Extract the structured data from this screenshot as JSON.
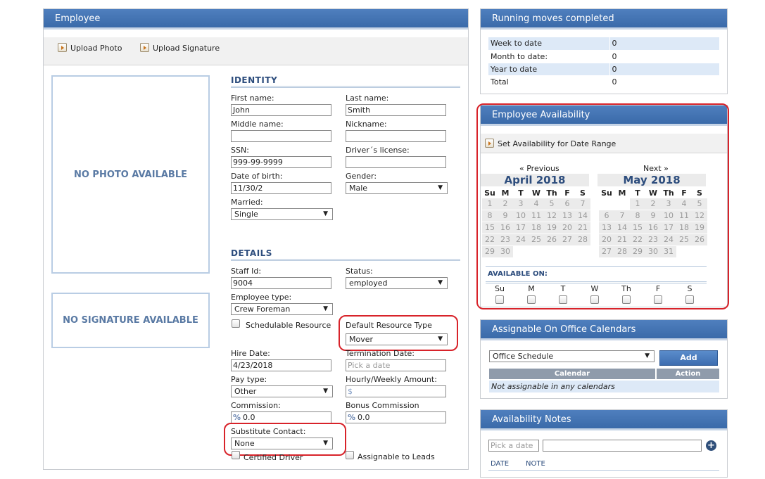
{
  "employee": {
    "title": "Employee",
    "toolbar": {
      "upload_photo": "Upload Photo",
      "upload_signature": "Upload Signature"
    },
    "photo_placeholder": "NO PHOTO AVAILABLE",
    "signature_placeholder": "NO SIGNATURE AVAILABLE",
    "identity": {
      "title": "IDENTITY",
      "first_name_label": "First name:",
      "first_name": "John",
      "last_name_label": "Last name:",
      "last_name": "Smith",
      "middle_name_label": "Middle name:",
      "middle_name": "",
      "nickname_label": "Nickname:",
      "nickname": "",
      "ssn_label": "SSN:",
      "ssn": "999-99-9999",
      "drivers_license_label": "Driver´s license:",
      "drivers_license": "",
      "dob_label": "Date of birth:",
      "dob": "11/30/2",
      "gender_label": "Gender:",
      "gender": "Male",
      "married_label": "Married:",
      "married": "Single"
    },
    "details": {
      "title": "DETAILS",
      "staff_id_label": "Staff Id:",
      "staff_id": "9004",
      "status_label": "Status:",
      "status": "employed",
      "employee_type_label": "Employee type:",
      "employee_type": "Crew Foreman",
      "schedulable_label": "Schedulable Resource",
      "default_resource_label": "Default Resource Type",
      "default_resource": "Mover",
      "hire_date_label": "Hire Date:",
      "hire_date": "4/23/2018",
      "termination_label": "Termination Date:",
      "termination_placeholder": "Pick a date",
      "pay_type_label": "Pay type:",
      "pay_type": "Other",
      "hourly_label": "Hourly/Weekly Amount:",
      "hourly_placeholder": "$",
      "commission_label": "Commission:",
      "commission": "0.0",
      "bonus_label": "Bonus Commission",
      "bonus": "0.0",
      "percent_symbol": "%",
      "substitute_label": "Substitute Contact:",
      "substitute": "None",
      "certified_label": "Certified Driver",
      "assignable_leads_label": "Assignable to Leads"
    }
  },
  "running_moves": {
    "title": "Running moves completed",
    "rows": [
      {
        "label": "Week to date",
        "value": "0"
      },
      {
        "label": "Month to date:",
        "value": "0"
      },
      {
        "label": "Year to date",
        "value": "0"
      },
      {
        "label": "Total",
        "value": "0"
      }
    ]
  },
  "availability": {
    "title": "Employee Availability",
    "set_range_label": "Set Availability for Date Range",
    "prev_label": "« Previous",
    "next_label": "Next »",
    "day_names": [
      "Su",
      "M",
      "T",
      "W",
      "Th",
      "F",
      "S"
    ],
    "april": {
      "title": "April 2018",
      "weeks": [
        [
          "1",
          "2",
          "3",
          "4",
          "5",
          "6",
          "7"
        ],
        [
          "8",
          "9",
          "10",
          "11",
          "12",
          "13",
          "14"
        ],
        [
          "15",
          "16",
          "17",
          "18",
          "19",
          "20",
          "21"
        ],
        [
          "22",
          "23",
          "24",
          "25",
          "26",
          "27",
          "28"
        ],
        [
          "29",
          "30",
          "",
          "",
          "",
          "",
          ""
        ]
      ]
    },
    "may": {
      "title": "May 2018",
      "weeks": [
        [
          "",
          "",
          "1",
          "2",
          "3",
          "4",
          "5"
        ],
        [
          "6",
          "7",
          "8",
          "9",
          "10",
          "11",
          "12"
        ],
        [
          "13",
          "14",
          "15",
          "16",
          "17",
          "18",
          "19"
        ],
        [
          "20",
          "21",
          "22",
          "23",
          "24",
          "25",
          "26"
        ],
        [
          "27",
          "28",
          "29",
          "30",
          "31",
          "",
          ""
        ]
      ]
    },
    "available_on_label": "AVAILABLE ON:",
    "weekday_labels": [
      "Su",
      "M",
      "T",
      "W",
      "Th",
      "F",
      "S"
    ]
  },
  "office_calendars": {
    "title": "Assignable On Office Calendars",
    "selected": "Office Schedule",
    "add_label": "Add",
    "col_calendar": "Calendar",
    "col_action": "Action",
    "empty_text": "Not assignable in any calendars"
  },
  "availability_notes": {
    "title": "Availability Notes",
    "date_placeholder": "Pick a date",
    "col_date": "DATE",
    "col_note": "NOTE"
  },
  "colors": {
    "accent": "#3a6aa9",
    "highlight_ring": "#d8232a"
  }
}
